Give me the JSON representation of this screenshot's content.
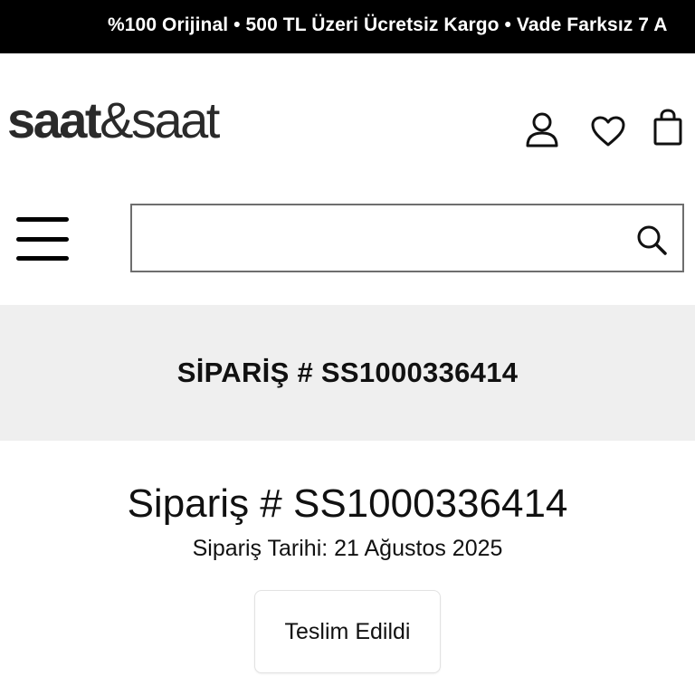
{
  "announcement": {
    "text": "%100 Orijinal • 500 TL Üzeri Ücretsiz Kargo • Vade Farksız 7 A"
  },
  "header": {
    "logo": {
      "part1": "saat",
      "amp": "&",
      "part2": "saat"
    },
    "icons": {
      "account": "user-icon",
      "wishlist": "heart-icon",
      "cart": "shopping-bag-icon",
      "menu": "hamburger-menu-icon",
      "search": "search-icon"
    }
  },
  "search": {
    "value": "",
    "placeholder": ""
  },
  "order_banner": {
    "title": "SİPARİŞ # SS1000336414"
  },
  "order": {
    "heading": "Sipariş # SS1000336414",
    "date": "Sipariş Tarihi: 21 Ağustos 2025",
    "status": "Teslim Edildi"
  },
  "colors": {
    "announcement_bg": "#000000",
    "banner_bg": "#efefef",
    "text": "#111111"
  }
}
